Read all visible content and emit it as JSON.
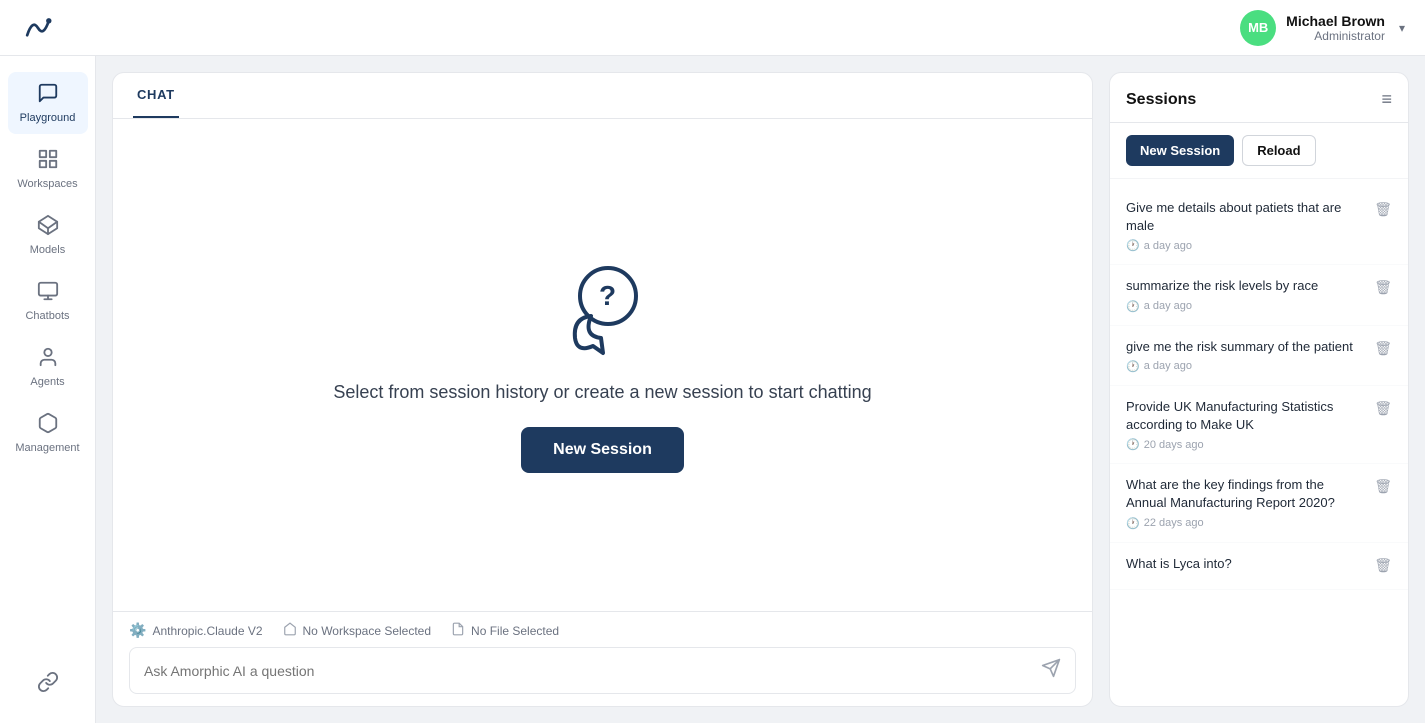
{
  "header": {
    "logo_alt": "Amorphic AI",
    "user": {
      "initials": "MB",
      "name": "Michael Brown",
      "role": "Administrator"
    }
  },
  "sidebar": {
    "items": [
      {
        "id": "playground",
        "label": "Playground",
        "icon": "💬",
        "active": true
      },
      {
        "id": "workspaces",
        "label": "Workspaces",
        "icon": "🗂️",
        "active": false
      },
      {
        "id": "models",
        "label": "Models",
        "icon": "🔷",
        "active": false
      },
      {
        "id": "chatbots",
        "label": "Chatbots",
        "icon": "🖥️",
        "active": false
      },
      {
        "id": "agents",
        "label": "Agents",
        "icon": "👤",
        "active": false
      },
      {
        "id": "management",
        "label": "Management",
        "icon": "🎒",
        "active": false
      }
    ],
    "bottom_item": {
      "id": "link",
      "label": "Link",
      "icon": "🔗"
    }
  },
  "chat": {
    "tab_label": "CHAT",
    "illustration_alt": "Question mark chat bubbles",
    "prompt_text": "Select from session history or create a new session to start chatting",
    "new_session_label": "New Session",
    "footer": {
      "model_label": "Anthropic.Claude V2",
      "workspace_label": "No Workspace Selected",
      "file_label": "No File Selected",
      "input_placeholder": "Ask Amorphic AI a question"
    }
  },
  "sessions": {
    "title": "Sessions",
    "new_session_label": "New Session",
    "reload_label": "Reload",
    "items": [
      {
        "id": 1,
        "text": "Give me details about patiets that are male",
        "time": "a day ago"
      },
      {
        "id": 2,
        "text": "summarize the risk levels by race",
        "time": "a day ago"
      },
      {
        "id": 3,
        "text": "give me the risk summary of the patient",
        "time": "a day ago"
      },
      {
        "id": 4,
        "text": "Provide UK Manufacturing Statistics according to Make UK",
        "time": "20 days ago"
      },
      {
        "id": 5,
        "text": "What are the key findings from the Annual Manufacturing Report 2020?",
        "time": "22 days ago"
      },
      {
        "id": 6,
        "text": "What is Lyca into?",
        "time": ""
      }
    ]
  }
}
